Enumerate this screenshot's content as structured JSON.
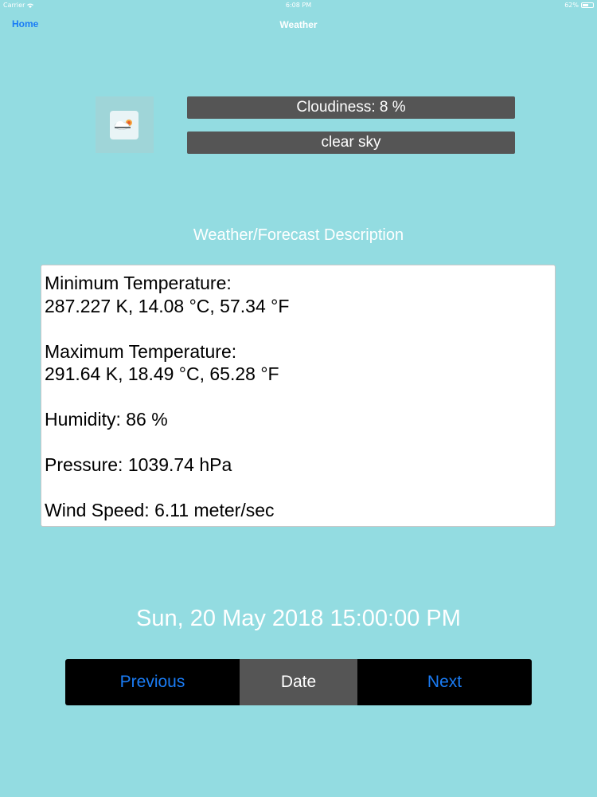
{
  "status_bar": {
    "carrier": "Carrier",
    "time": "6:08 PM",
    "battery": "62%",
    "battery_level": 0.62,
    "icons": [
      "wifi-icon",
      "battery-icon"
    ]
  },
  "nav": {
    "back_label": "Home",
    "title": "Weather"
  },
  "weather": {
    "icon": "partly-cloudy-icon",
    "cloudiness": "Cloudiness: 8 %",
    "description": "clear sky"
  },
  "section_label": "Weather/Forecast Description",
  "details": {
    "min_label": "Minimum Temperature:",
    "min_value": "287.227 K, 14.08 °C, 57.34 °F",
    "max_label": "Maximum Temperature:",
    "max_value": "291.64 K, 18.49 °C, 65.28 °F",
    "humidity": "Humidity: 86 %",
    "pressure": "Pressure: 1039.74 hPa",
    "wind": "Wind Speed: 6.11 meter/sec"
  },
  "date": "Sun, 20 May 2018 15:00:00 PM",
  "buttons": {
    "previous": "Previous",
    "date": "Date",
    "next": "Next"
  },
  "colors": {
    "background": "#93dce1",
    "accent": "#1a7cf5",
    "bar": "#555555"
  }
}
